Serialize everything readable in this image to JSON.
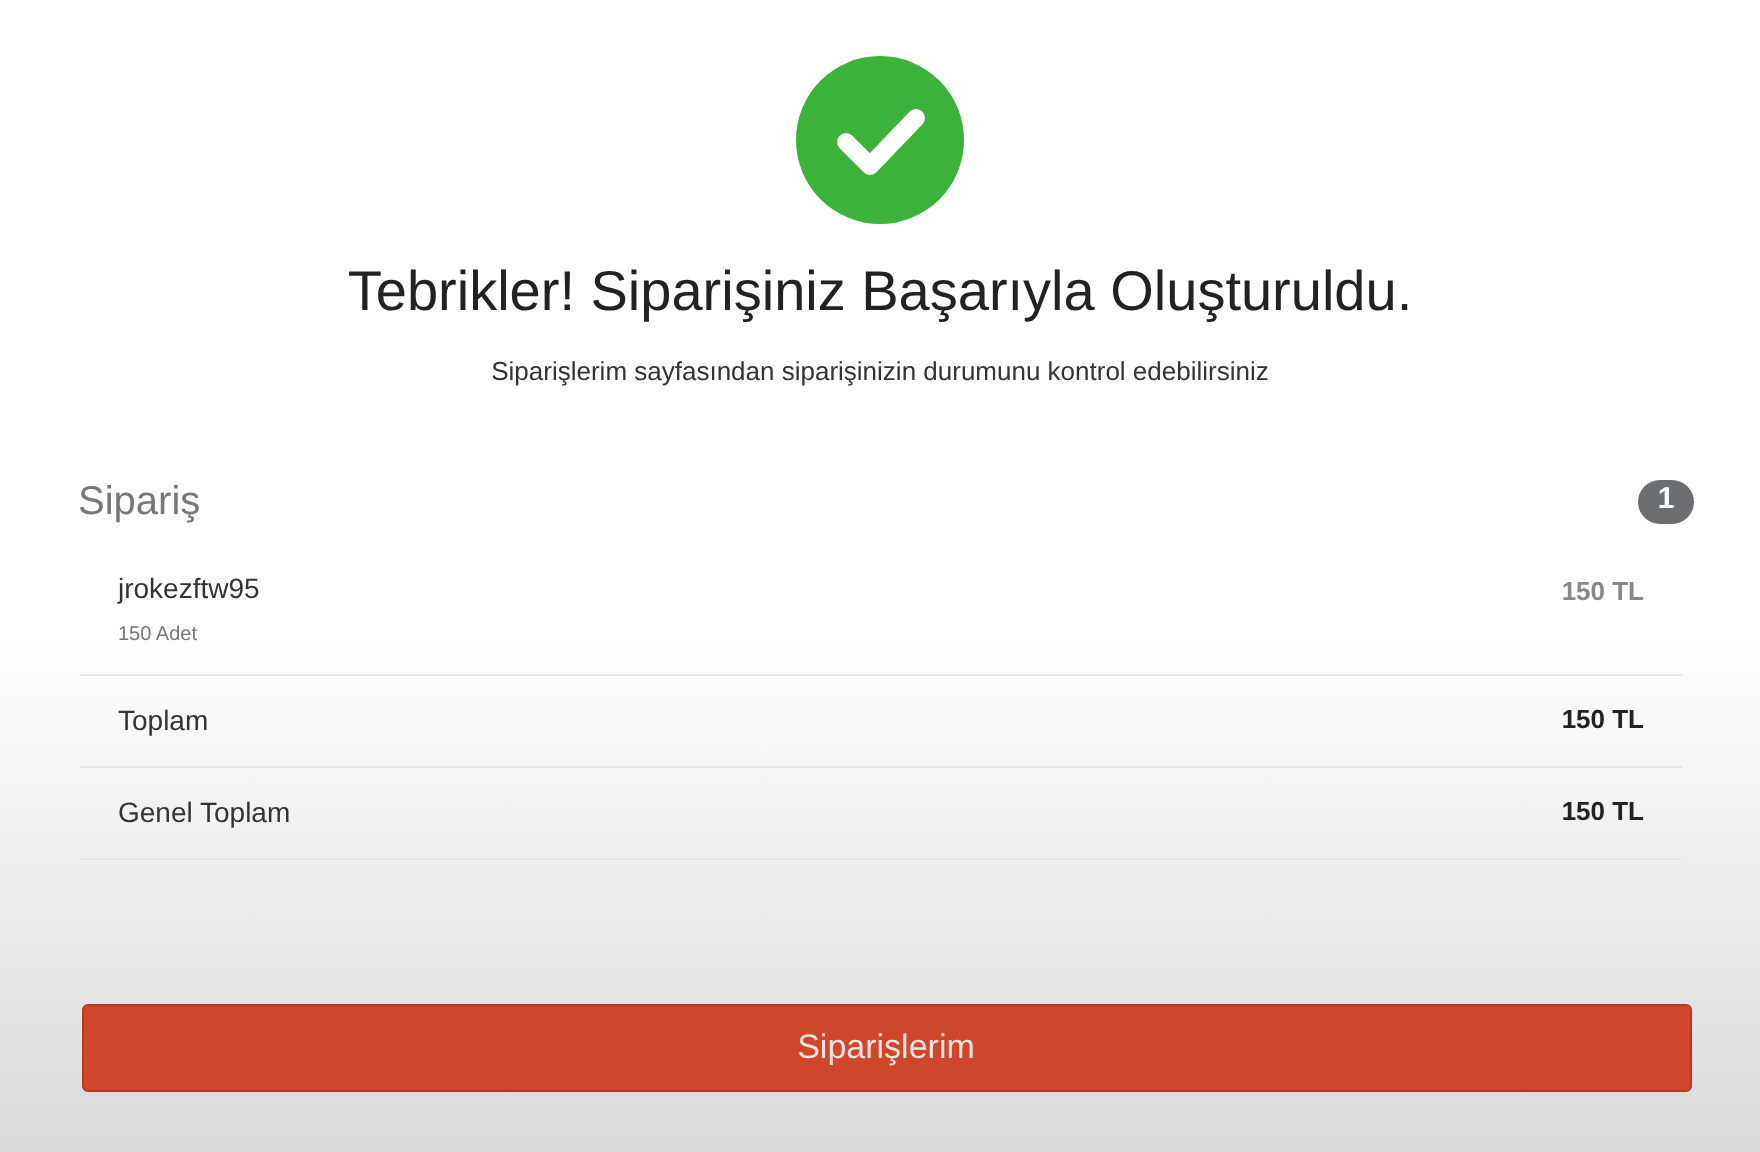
{
  "title": "Tebrikler! Siparişiniz Başarıyla Oluşturuldu.",
  "subtitle": "Siparişlerim sayfasından siparişinizin durumunu kontrol edebilirsiniz",
  "order": {
    "heading": "Sipariş",
    "count": "1",
    "items": [
      {
        "name": "jrokezftw95",
        "quantity": "150 Adet",
        "price": "150 TL"
      }
    ],
    "totals": [
      {
        "label": "Toplam",
        "value": "150 TL"
      },
      {
        "label": "Genel Toplam",
        "value": "150 TL"
      }
    ]
  },
  "button": "Siparişlerim"
}
